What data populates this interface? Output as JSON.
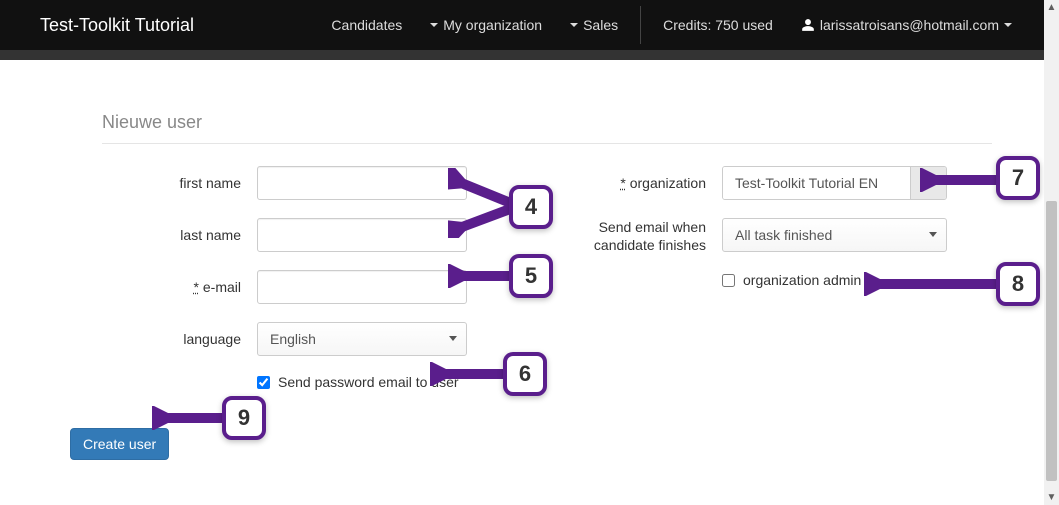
{
  "brand": "Test-Toolkit Tutorial",
  "nav": {
    "candidates": "Candidates",
    "myorg": "My organization",
    "sales": "Sales",
    "credits": "Credits: 750 used",
    "user_email": "larissatroisans@hotmail.com"
  },
  "page_title": "Nieuwe user",
  "labels": {
    "first_name": "first name",
    "last_name": "last name",
    "email": "e-mail",
    "language": "language",
    "send_pw": "Send password email to user",
    "organization": "organization",
    "send_email_when": "Send email when candidate finishes",
    "org_admin": "organization admin"
  },
  "values": {
    "first_name": "",
    "last_name": "",
    "email": "",
    "language_selected": "English",
    "send_pw_checked": true,
    "organization_selected": "Test-Toolkit Tutorial EN",
    "finish_email_selected": "All task finished",
    "org_admin_checked": false
  },
  "buttons": {
    "create_user": "Create user"
  },
  "annotations": {
    "n4": "4",
    "n5": "5",
    "n6": "6",
    "n7": "7",
    "n8": "8",
    "n9": "9"
  },
  "required_prefix": "*"
}
